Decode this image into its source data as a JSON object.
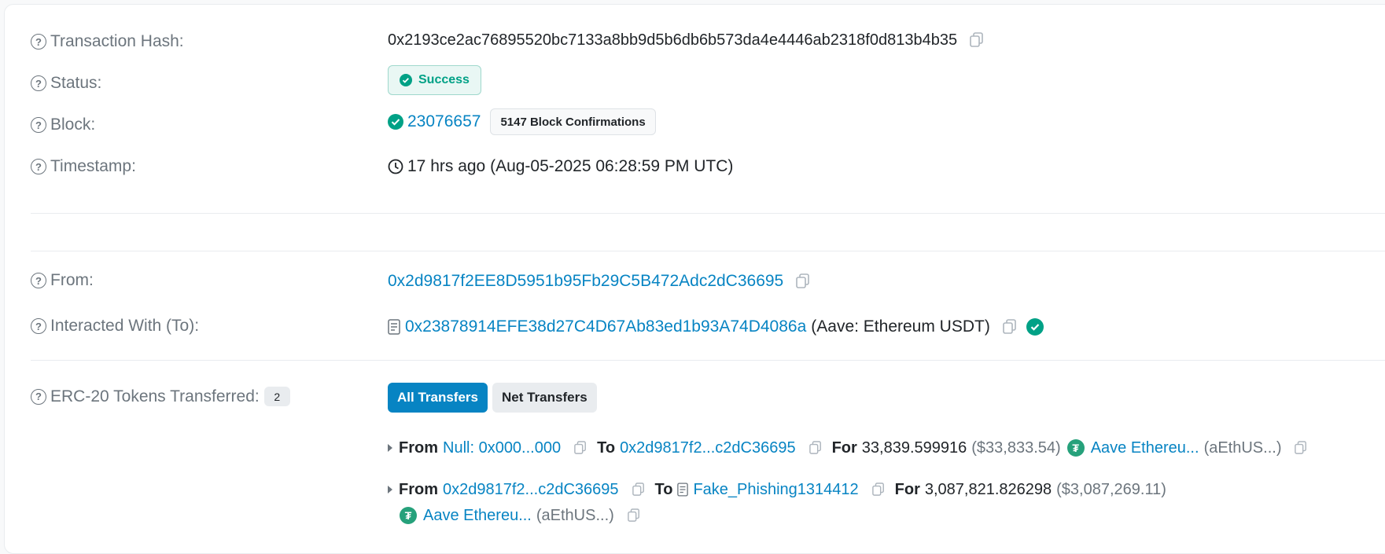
{
  "tx": {
    "hash_label": "Transaction Hash:",
    "hash": "0x2193ce2ac76895520bc7133a8bb9d5b6db6b573da4e4446ab2318f0d813b4b35",
    "status_label": "Status:",
    "status": "Success",
    "block_label": "Block:",
    "block": "23076657",
    "confirmations": "5147 Block Confirmations",
    "timestamp_label": "Timestamp:",
    "timestamp": "17 hrs ago (Aug-05-2025 06:28:59 PM UTC)",
    "from_label": "From:",
    "from": "0x2d9817f2EE8D5951b95Fb29C5B472Adc2dC36695",
    "to_label": "Interacted With (To):",
    "to": "0x23878914EFE38d27C4D67Ab83ed1b93A74D4086a",
    "to_name": "(Aave: Ethereum USDT)",
    "erc20_label": "ERC-20 Tokens Transferred:",
    "erc20_count": "2"
  },
  "tabs": {
    "all": "All Transfers",
    "net": "Net Transfers"
  },
  "transfers": [
    {
      "from_kw": "From",
      "from": "Null: 0x000...000",
      "to_kw": "To",
      "to": "0x2d9817f2...c2dC36695",
      "for_kw": "For",
      "amount": "33,839.599916",
      "usd": "($33,833.54)",
      "token": "Aave Ethereu...",
      "symbol": "(aEthUS...)"
    },
    {
      "from_kw": "From",
      "from": "0x2d9817f2...c2dC36695",
      "to_kw": "To",
      "to": "Fake_Phishing1314412",
      "for_kw": "For",
      "amount": "3,087,821.826298",
      "usd": "($3,087,269.11)",
      "token": "Aave Ethereu...",
      "symbol": "(aEthUS...)"
    }
  ],
  "colors": {
    "link": "#0784c3",
    "success": "#00a186",
    "tether": "#26a17b"
  }
}
